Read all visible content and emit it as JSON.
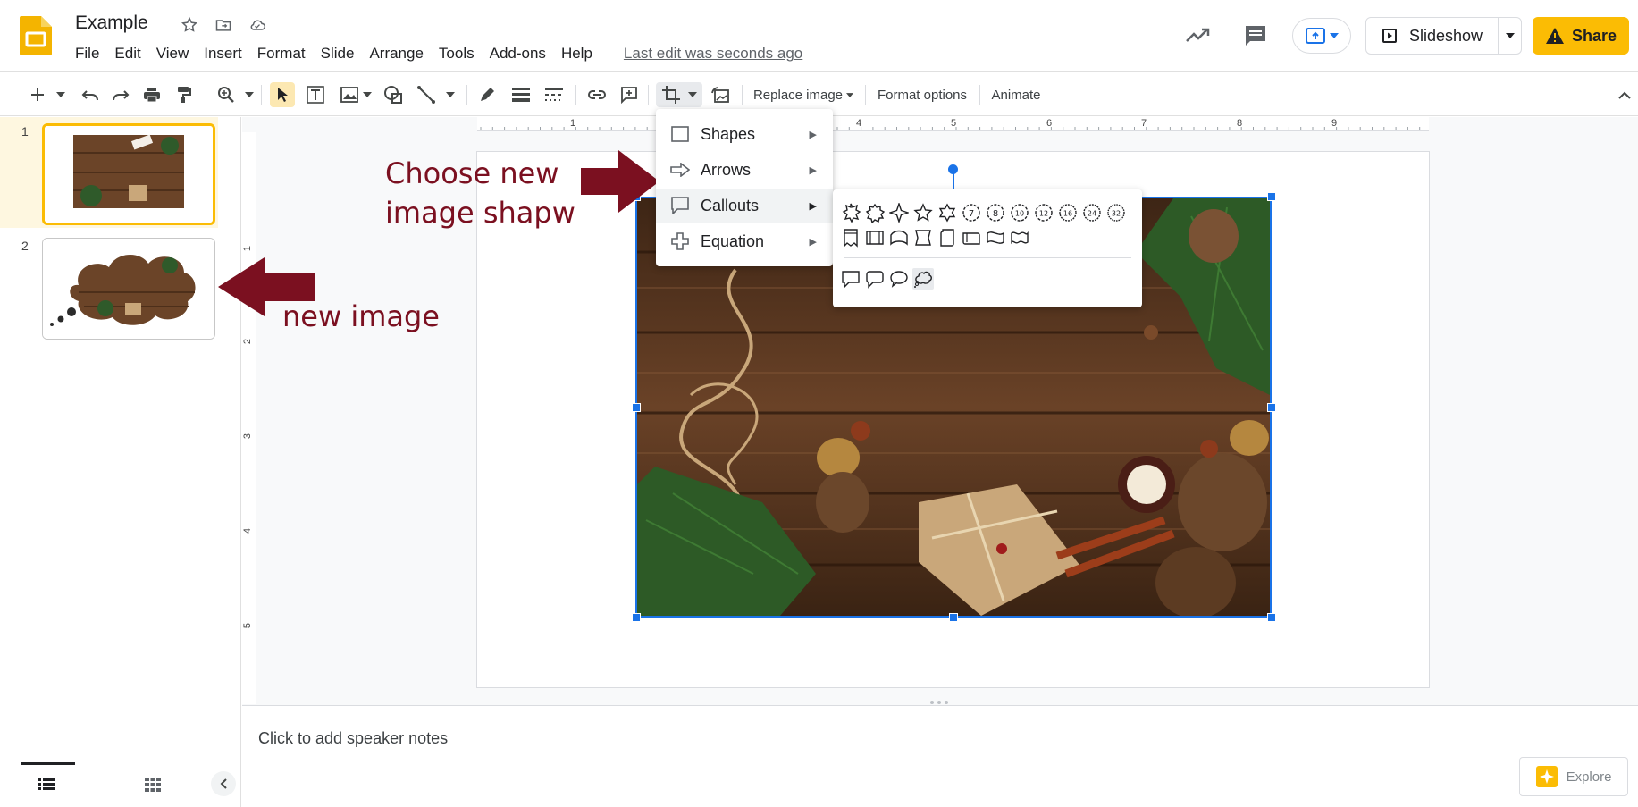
{
  "header": {
    "doc_title": "Example",
    "menus": [
      "File",
      "Edit",
      "View",
      "Insert",
      "Format",
      "Slide",
      "Arrange",
      "Tools",
      "Add-ons",
      "Help"
    ],
    "last_edit": "Last edit was seconds ago",
    "slideshow_label": "Slideshow",
    "share_label": "Share"
  },
  "toolbar": {
    "replace_image_label": "Replace image",
    "format_options_label": "Format options",
    "animate_label": "Animate"
  },
  "ruler": {
    "h_ticks": [
      "1",
      "2",
      "3",
      "4",
      "5",
      "6",
      "7",
      "8",
      "9"
    ],
    "v_ticks": [
      "1",
      "2",
      "3",
      "4",
      "5"
    ]
  },
  "filmstrip": {
    "slides": [
      {
        "number": "1"
      },
      {
        "number": "2"
      }
    ]
  },
  "mask_menu": {
    "items": [
      {
        "label": "Shapes",
        "icon": "square-icon"
      },
      {
        "label": "Arrows",
        "icon": "arrow-outline-icon"
      },
      {
        "label": "Callouts",
        "icon": "callout-icon"
      },
      {
        "label": "Equation",
        "icon": "plus-outline-icon"
      }
    ],
    "open_item": "Callouts"
  },
  "submenu": {
    "badge_labels": [
      "7",
      "8",
      "10",
      "12",
      "16",
      "24",
      "32"
    ]
  },
  "annotations": {
    "choose_line1": "Choose new",
    "choose_line2": "image shapw",
    "new_image": "new image"
  },
  "notes": {
    "placeholder": "Click to add speaker notes"
  },
  "explore_label": "Explore",
  "colors": {
    "accent": "#1a73e8",
    "share": "#fbbc04",
    "annotation": "#7b1020",
    "slides_logo": "#f4b400"
  }
}
